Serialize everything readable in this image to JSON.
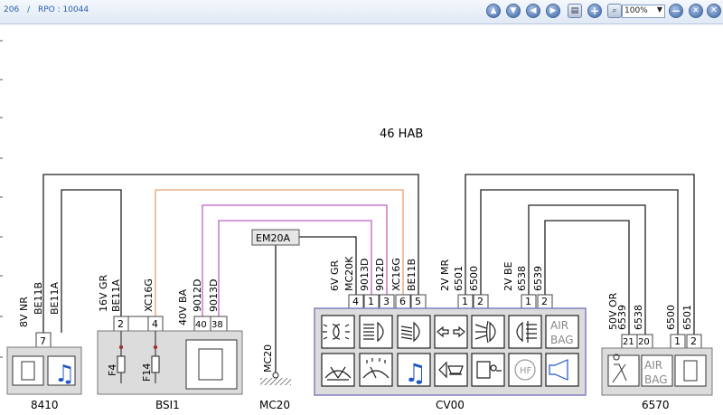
{
  "toolbar": {
    "doc_number": "206",
    "separator": "/",
    "rpo": "RPO : 10044",
    "zoom_value": "100%"
  },
  "diagram": {
    "title": "46 HAB",
    "components": {
      "c8410": {
        "label": "8410",
        "pin": "7",
        "conn": "8V NR",
        "wires": [
          "BE11B",
          "BE11A"
        ]
      },
      "bsi1": {
        "label": "BSI1",
        "pins_left": [
          "2",
          "4"
        ],
        "conn_left": "16V GR",
        "wires_left": [
          "BE11A",
          "XC16G"
        ],
        "fuses": [
          "F4",
          "F14"
        ],
        "pins_right": [
          "40",
          "38"
        ],
        "conn_right": "40V BA",
        "wires_right": [
          "9012D",
          "9013D"
        ]
      },
      "mc20": {
        "label": "MC20",
        "wire": "MC20"
      },
      "em20a": {
        "label": "EM20A"
      },
      "cv00": {
        "label": "CV00",
        "conn1": "6V GR",
        "pins1": [
          "4",
          "1",
          "3",
          "6",
          "5"
        ],
        "wires1": [
          "MC20K",
          "9013D",
          "9012D",
          "XC16G",
          "BE11B"
        ],
        "conn2": "2V MR",
        "pins2": [
          "1",
          "2"
        ],
        "wires2": [
          "6501",
          "6500"
        ],
        "conn3": "2V BE",
        "pins3": [
          "1",
          "2"
        ],
        "wires3": [
          "6538",
          "6539"
        ],
        "airbag_text": [
          "AIR",
          "BAG"
        ]
      },
      "c6570": {
        "label": "6570",
        "conn": "50V OR",
        "pins": [
          "21",
          "20",
          "1",
          "2"
        ],
        "wires": [
          "6539",
          "6538",
          "6500",
          "6501"
        ],
        "airbag_text": [
          "AIR",
          "BAG"
        ]
      }
    },
    "colors": {
      "orange_wire": "#e8a070",
      "violet_wire": "#c060c8",
      "cv00_border": "#8080c0",
      "icon_blue": "#1f56c8"
    }
  }
}
